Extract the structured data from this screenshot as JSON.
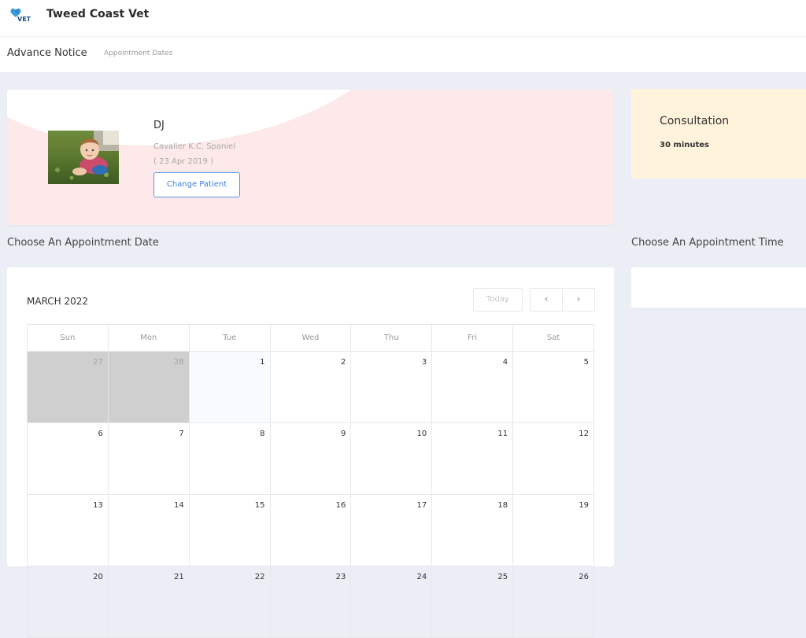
{
  "header": {
    "brand": "Tweed Coast Vet",
    "logo_text": "VET"
  },
  "subheader": {
    "title": "Advance Notice",
    "crumb": "Appointment Dates"
  },
  "patient": {
    "name": "DJ",
    "breed": "Cavalier K.C. Spaniel",
    "dob": "( 23 Apr 2019 )",
    "change_label": "Change Patient"
  },
  "service": {
    "title": "Consultation",
    "duration": "30 minutes"
  },
  "sections": {
    "date_title": "Choose An Appointment Date",
    "time_title": "Choose An Appointment Time"
  },
  "calendar": {
    "month_label": "MARCH 2022",
    "today_label": "Today",
    "prev_icon": "‹",
    "next_icon": "›",
    "weekdays": [
      "Sun",
      "Mon",
      "Tue",
      "Wed",
      "Thu",
      "Fri",
      "Sat"
    ],
    "weeks": [
      [
        "27",
        "28",
        "1",
        "2",
        "3",
        "4",
        "5"
      ],
      [
        "6",
        "7",
        "8",
        "9",
        "10",
        "11",
        "12"
      ],
      [
        "13",
        "14",
        "15",
        "16",
        "17",
        "18",
        "19"
      ],
      [
        "20",
        "21",
        "22",
        "23",
        "24",
        "25",
        "26"
      ]
    ]
  },
  "colors": {
    "accent": "#3f7fdf",
    "patient_card": "#fde9ea",
    "service_card": "#fff3db",
    "page_bg": "#eceef6"
  }
}
